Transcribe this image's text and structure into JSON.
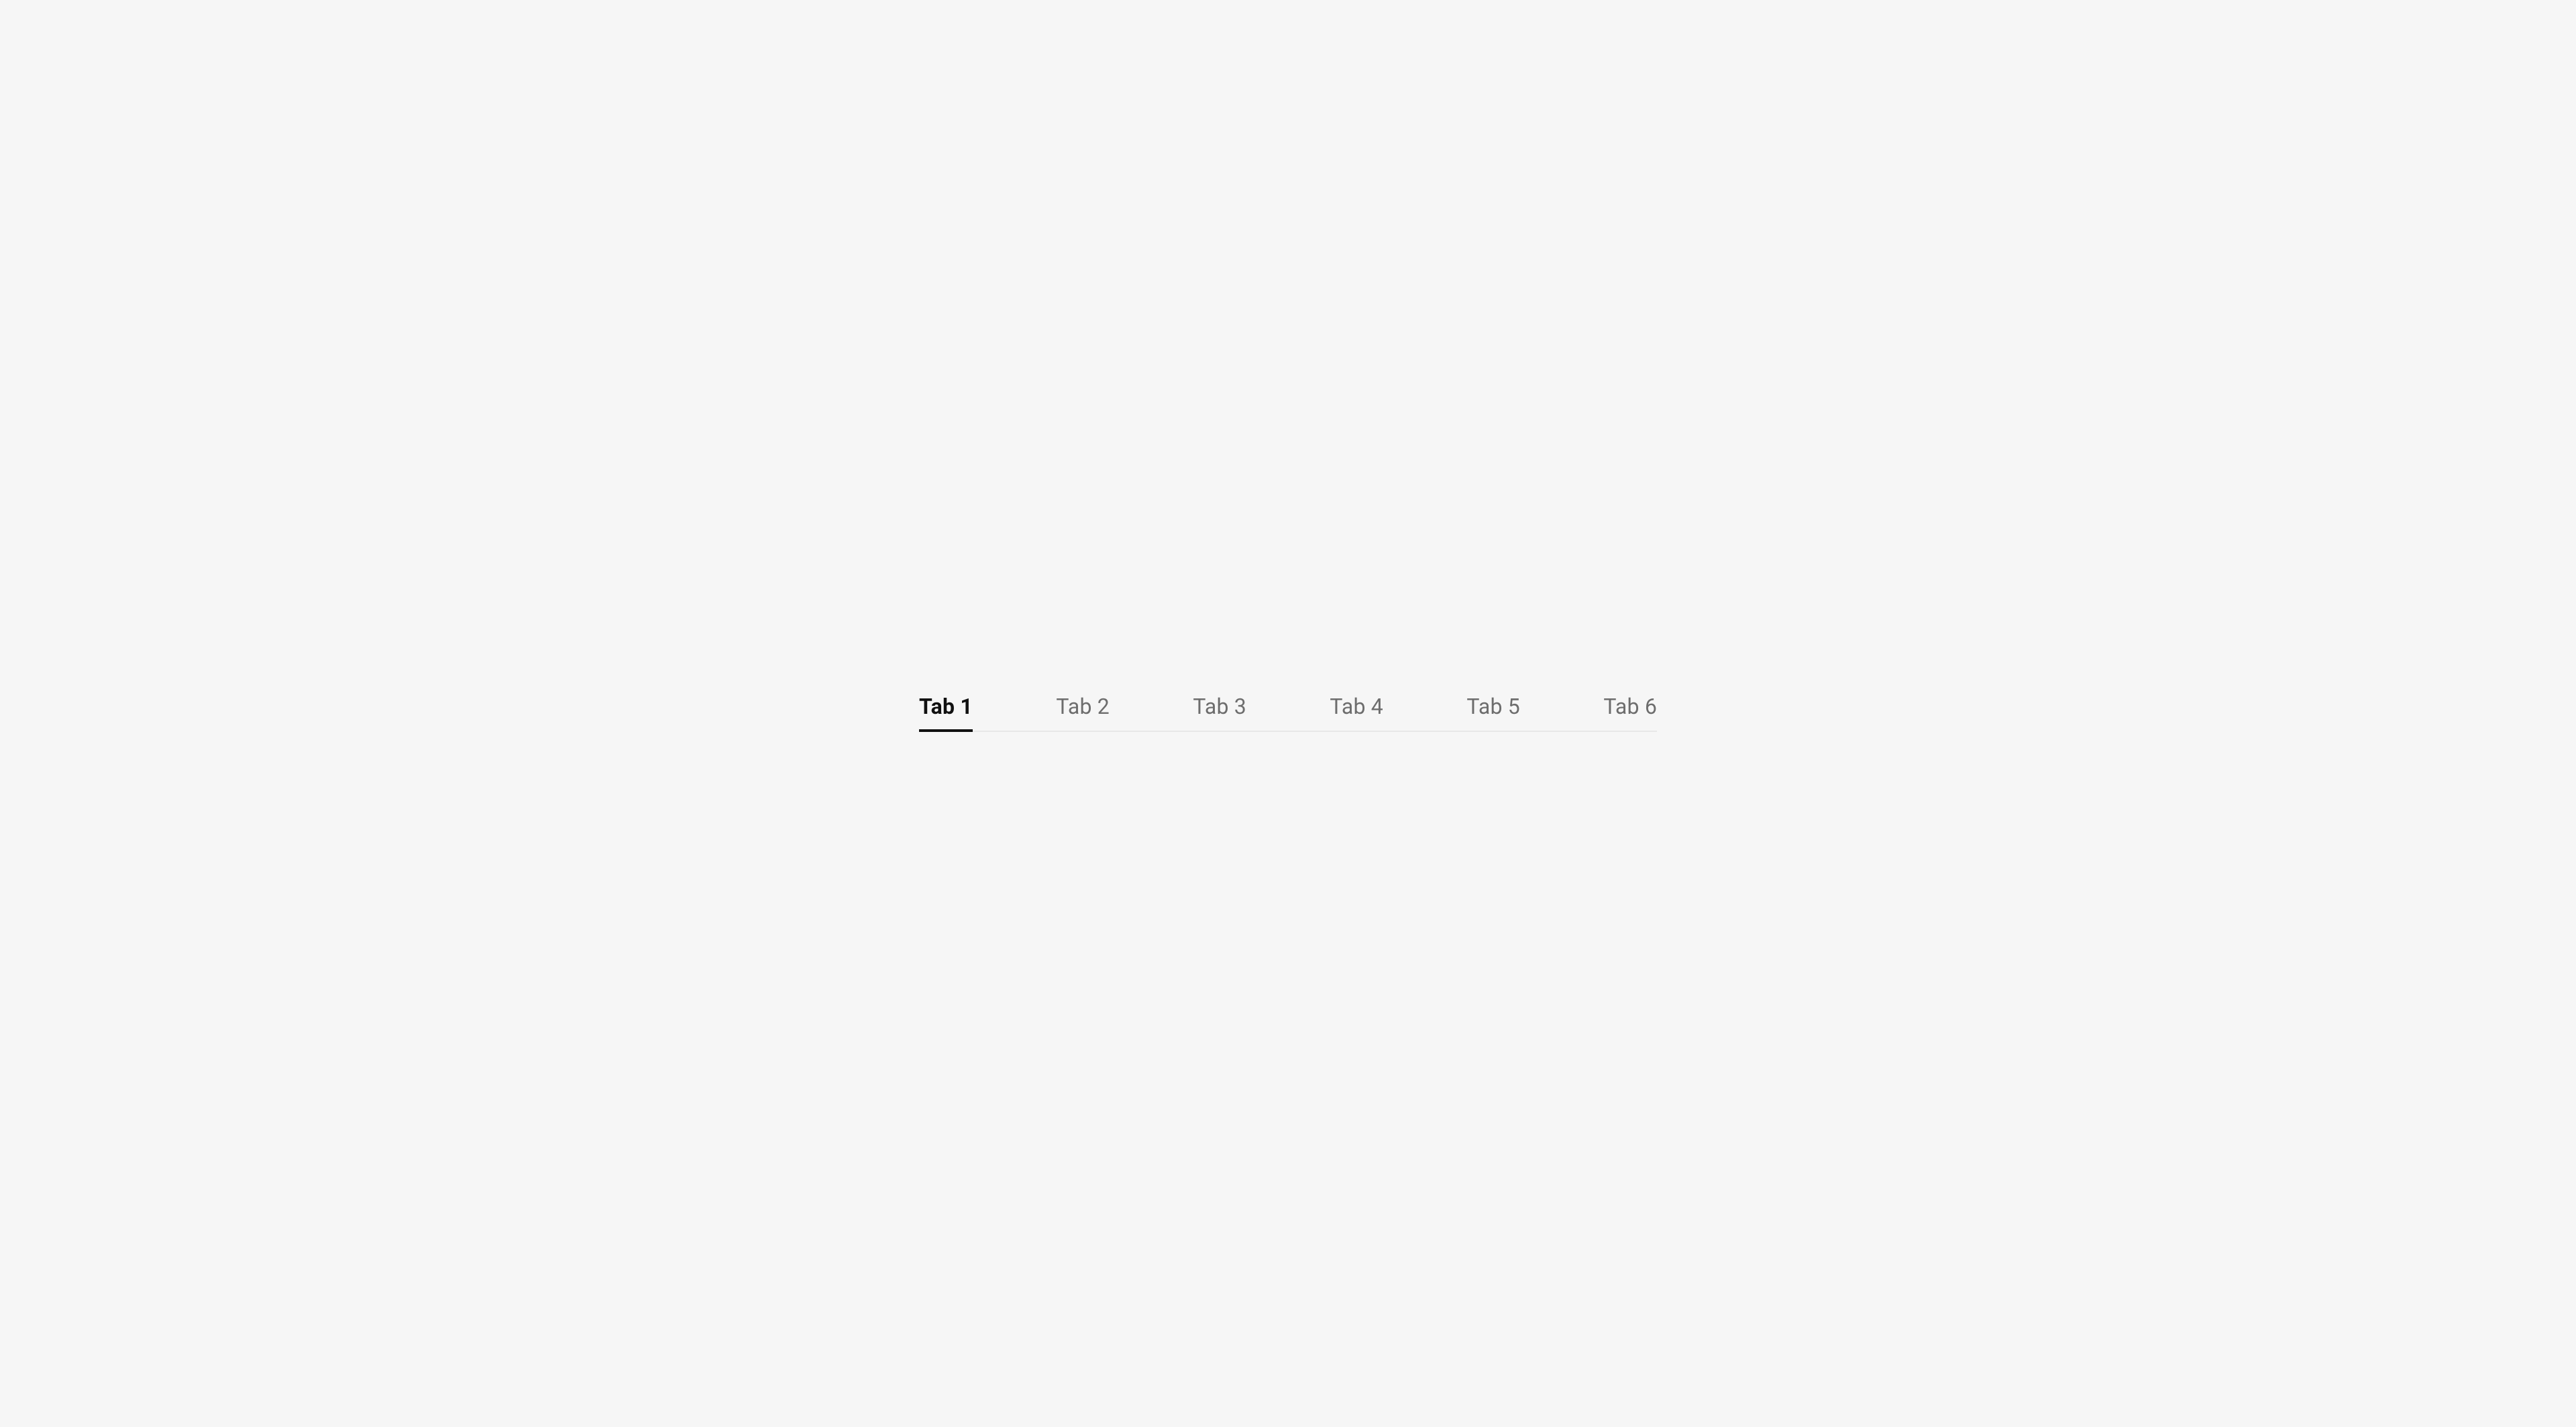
{
  "tabs": {
    "active_index": 0,
    "items": [
      {
        "label": "Tab 1"
      },
      {
        "label": "Tab 2"
      },
      {
        "label": "Tab 3"
      },
      {
        "label": "Tab 4"
      },
      {
        "label": "Tab 5"
      },
      {
        "label": "Tab 6"
      }
    ]
  }
}
